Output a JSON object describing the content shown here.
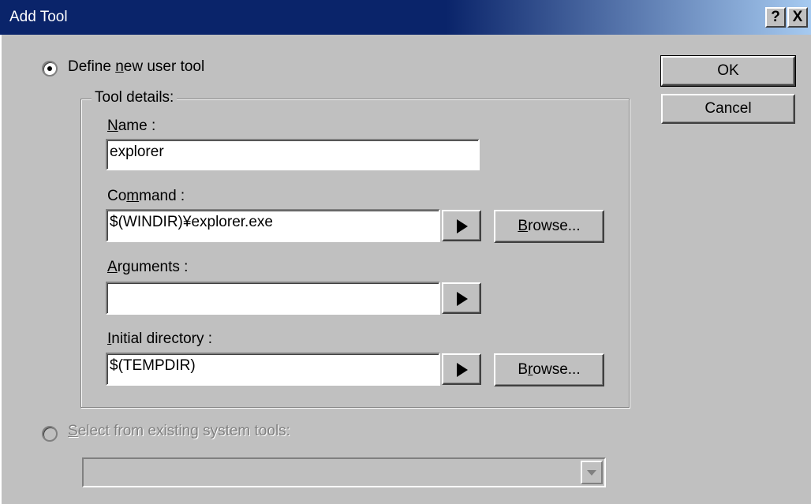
{
  "window": {
    "title": "Add Tool",
    "help_button": "?",
    "close_button": "X"
  },
  "options": {
    "define_new": {
      "label_prefix": "Define ",
      "label_accel": "n",
      "label_suffix": "ew user tool",
      "selected": true
    },
    "select_existing": {
      "label_accel": "S",
      "label_suffix": "elect from existing system tools:",
      "selected": false,
      "enabled": false
    }
  },
  "tool_details": {
    "legend": "Tool details:",
    "name": {
      "label_accel": "N",
      "label_suffix": "ame :",
      "value": "explorer"
    },
    "command": {
      "label_prefix": "Co",
      "label_accel": "m",
      "label_suffix": "mand :",
      "value": "$(WINDIR)¥explorer.exe",
      "browse_accel": "B",
      "browse_suffix": "rowse..."
    },
    "arguments": {
      "label_accel": "A",
      "label_suffix": "rguments :",
      "value": ""
    },
    "initial_directory": {
      "label_accel": "I",
      "label_suffix": "nitial directory :",
      "value": "$(TEMPDIR)",
      "browse_prefix": "B",
      "browse_accel": "r",
      "browse_suffix": "owse..."
    }
  },
  "buttons": {
    "ok": "OK",
    "cancel": "Cancel"
  },
  "system_tools_combo": {
    "value": ""
  },
  "icons": {
    "arrow": "right-triangle-icon",
    "dropdown": "chevron-down-icon"
  }
}
